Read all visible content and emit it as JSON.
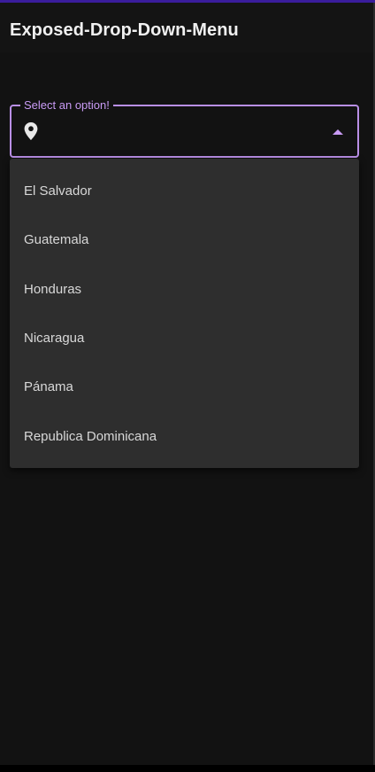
{
  "app": {
    "title": "Exposed-Drop-Down-Menu"
  },
  "dropdown": {
    "label": "Select an option!",
    "value": "",
    "leading_icon": "location-pin-icon",
    "trailing_icon": "arrow-drop-up-icon",
    "expanded": true,
    "options": [
      "El Salvador",
      "Guatemala",
      "Honduras",
      "Nicaragua",
      "Pánama",
      "Republica Dominicana"
    ]
  },
  "colors": {
    "background": "#121212",
    "accent": "#b98fe6",
    "label": "#c99bf5",
    "menu_surface": "#2e2e2e",
    "status_accent": "#3a1d9c"
  }
}
